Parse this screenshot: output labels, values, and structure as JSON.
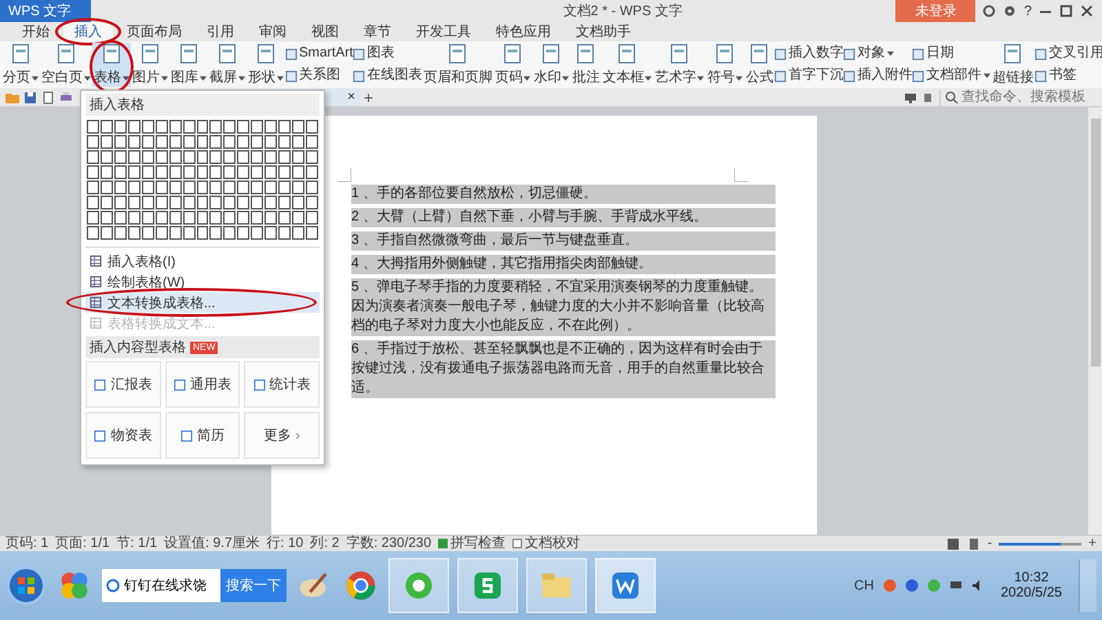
{
  "app_button": {
    "label": "WPS 文字"
  },
  "window": {
    "title": "文档2 * - WPS 文字",
    "help": "?"
  },
  "login_button": {
    "label": "未登录"
  },
  "menu_tabs": [
    {
      "label": "开始",
      "selected": false,
      "annotated": false
    },
    {
      "label": "插入",
      "selected": true,
      "annotated": true
    },
    {
      "label": "页面布局",
      "selected": false,
      "annotated": false
    },
    {
      "label": "引用",
      "selected": false,
      "annotated": false
    },
    {
      "label": "审阅",
      "selected": false,
      "annotated": false
    },
    {
      "label": "视图",
      "selected": false,
      "annotated": false
    },
    {
      "label": "章节",
      "selected": false,
      "annotated": false
    },
    {
      "label": "开发工具",
      "selected": false,
      "annotated": false
    },
    {
      "label": "特色应用",
      "selected": false,
      "annotated": false
    },
    {
      "label": "文档助手",
      "selected": false,
      "annotated": false
    }
  ],
  "ribbon": [
    {
      "kind": "large",
      "label": "分页",
      "menu": true,
      "selected": false,
      "annotated": false
    },
    {
      "kind": "large",
      "label": "空白页",
      "menu": true,
      "selected": false,
      "annotated": false
    },
    {
      "kind": "large",
      "label": "表格",
      "menu": true,
      "selected": true,
      "annotated": true
    },
    {
      "kind": "large",
      "label": "图片",
      "menu": true,
      "selected": false,
      "annotated": false
    },
    {
      "kind": "large",
      "label": "图库",
      "menu": true,
      "selected": false,
      "annotated": false
    },
    {
      "kind": "large",
      "label": "截屏",
      "menu": true,
      "selected": false,
      "annotated": false
    },
    {
      "kind": "large",
      "label": "形状",
      "menu": true,
      "selected": false,
      "annotated": false
    },
    {
      "kind": "stack",
      "items": [
        {
          "label": "SmartArt",
          "menu": false
        },
        {
          "label": "关系图",
          "menu": false
        }
      ]
    },
    {
      "kind": "stack",
      "items": [
        {
          "label": "图表",
          "menu": false
        },
        {
          "label": "在线图表",
          "menu": false
        }
      ]
    },
    {
      "kind": "separator"
    },
    {
      "kind": "large",
      "label": "页眉和页脚",
      "menu": false,
      "selected": false,
      "annotated": false
    },
    {
      "kind": "large",
      "label": "页码",
      "menu": true,
      "selected": false,
      "annotated": false
    },
    {
      "kind": "large",
      "label": "水印",
      "menu": true,
      "selected": false,
      "annotated": false
    },
    {
      "kind": "separator"
    },
    {
      "kind": "large",
      "label": "批注",
      "menu": false,
      "selected": false,
      "annotated": false
    },
    {
      "kind": "separator"
    },
    {
      "kind": "large",
      "label": "文本框",
      "menu": true,
      "selected": false,
      "annotated": false
    },
    {
      "kind": "large",
      "label": "艺术字",
      "menu": true,
      "selected": false,
      "annotated": false
    },
    {
      "kind": "separator"
    },
    {
      "kind": "large",
      "label": "符号",
      "menu": true,
      "selected": false,
      "annotated": false
    },
    {
      "kind": "large",
      "label": "公式",
      "menu": false,
      "selected": false,
      "annotated": false
    },
    {
      "kind": "stack",
      "items": [
        {
          "label": "插入数字",
          "menu": false
        },
        {
          "label": "首字下沉",
          "menu": false
        }
      ]
    },
    {
      "kind": "stack",
      "items": [
        {
          "label": "对象",
          "menu": true
        },
        {
          "label": "插入附件",
          "menu": false
        }
      ]
    },
    {
      "kind": "stack",
      "items": [
        {
          "label": "日期",
          "menu": false
        },
        {
          "label": "文档部件",
          "menu": true
        }
      ]
    },
    {
      "kind": "separator"
    },
    {
      "kind": "large",
      "label": "超链接",
      "menu": false,
      "selected": false,
      "annotated": false
    },
    {
      "kind": "stack",
      "items": [
        {
          "label": "交叉引用",
          "menu": false
        },
        {
          "label": "书签",
          "menu": false
        }
      ]
    },
    {
      "kind": "separator"
    },
    {
      "kind": "icons"
    }
  ],
  "doc_tab": {
    "close": "×",
    "new": "+"
  },
  "command_search": {
    "placeholder": "查找命令、搜索模板"
  },
  "table_menu": {
    "title": "插入表格",
    "items": [
      {
        "label": "插入表格(I)",
        "disabled": false,
        "highlighted": false,
        "annotated": false
      },
      {
        "label": "绘制表格(W)",
        "disabled": false,
        "highlighted": false,
        "annotated": false
      },
      {
        "label": "文本转换成表格...",
        "disabled": false,
        "highlighted": true,
        "annotated": true
      },
      {
        "label": "表格转换成文本...",
        "disabled": true,
        "highlighted": false,
        "annotated": false
      }
    ],
    "section": {
      "label": "插入内容型表格",
      "badge": "NEW"
    },
    "templates": [
      {
        "label": "汇报表"
      },
      {
        "label": "通用表"
      },
      {
        "label": "统计表"
      },
      {
        "label": "物资表"
      },
      {
        "label": "简历"
      },
      {
        "label": "更多",
        "arrow": "›"
      }
    ]
  },
  "document": {
    "selected": true,
    "paragraphs": [
      "1 、手的各部位要自然放松，切忌僵硬。",
      "2 、大臂（上臂）自然下垂，小臂与手腕、手背成水平线。",
      "3 、手指自然微微弯曲，最后一节与键盘垂直。",
      "4 、大拇指用外侧触键，其它指用指尖肉部触键。",
      "5 、弹电子琴手指的力度要稍轻，不宜采用演奏钢琴的力度重触键。因为演奏者演奏一般电子琴，触键力度的大小并不影响音量（比较高档的电子琴对力度大小也能反应，不在此例）。",
      "6 、手指过于放松、甚至轻飘飘也是不正确的，因为这样有时会由于按键过浅，没有拨通电子振荡器电路而无音，用手的自然重量比较合适。"
    ]
  },
  "status_bar": {
    "items": [
      "页码: 1",
      "页面: 1/1",
      "节: 1/1",
      "设置值: 9.7厘米",
      "行: 10",
      "列: 2",
      "字数: 230/230"
    ],
    "spell_check": {
      "label": "拼写检查",
      "checked": true
    },
    "proofread": {
      "label": "文档校对",
      "checked": false
    },
    "zoom": {
      "level": 0.75,
      "minus": "-",
      "plus": "+"
    }
  },
  "taskbar": {
    "search": {
      "value": "钉钉在线求饶",
      "button": "搜索一下"
    },
    "tray": {
      "language": "CH",
      "time": "10:32",
      "date": "2020/5/25"
    }
  }
}
